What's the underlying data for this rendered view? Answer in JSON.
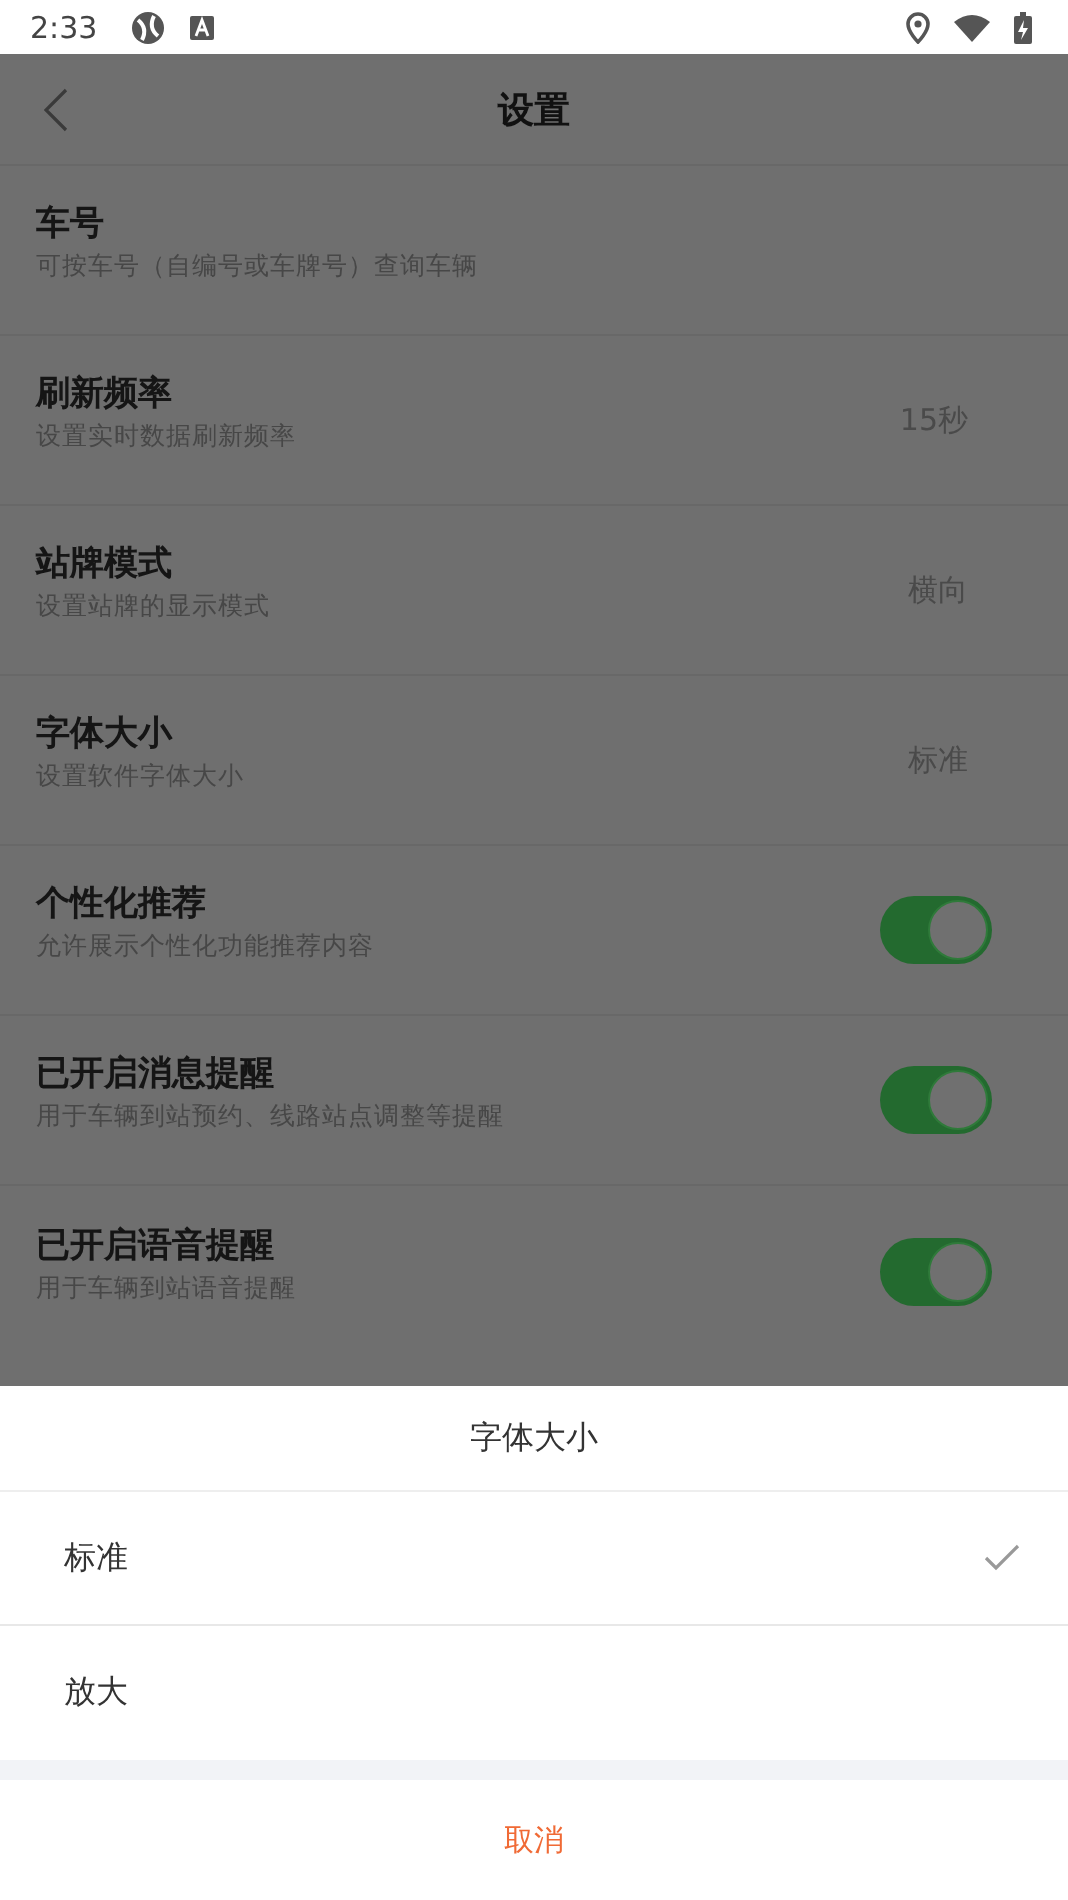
{
  "status_bar": {
    "time": "2:33"
  },
  "header": {
    "title": "设置"
  },
  "settings": [
    {
      "kind": "plain",
      "title": "车号",
      "subtitle": "可按车号（自编号或车牌号）查询车辆"
    },
    {
      "kind": "value",
      "title": "刷新频率",
      "subtitle": "设置实时数据刷新频率",
      "value": "15秒"
    },
    {
      "kind": "value",
      "title": "站牌模式",
      "subtitle": "设置站牌的显示模式",
      "value": "横向"
    },
    {
      "kind": "value",
      "title": "字体大小",
      "subtitle": "设置软件字体大小",
      "value": "标准"
    },
    {
      "kind": "toggle",
      "title": "个性化推荐",
      "subtitle": "允许展示个性化功能推荐内容",
      "on": true
    },
    {
      "kind": "toggle",
      "title": "已开启消息提醒",
      "subtitle": "用于车辆到站预约、线路站点调整等提醒",
      "on": true
    },
    {
      "kind": "toggle",
      "title": "已开启语音提醒",
      "subtitle": "用于车辆到站语音提醒",
      "on": true
    }
  ],
  "sheet": {
    "title": "字体大小",
    "options": [
      {
        "label": "标准",
        "selected": true
      },
      {
        "label": "放大",
        "selected": false
      }
    ],
    "cancel": "取消"
  }
}
